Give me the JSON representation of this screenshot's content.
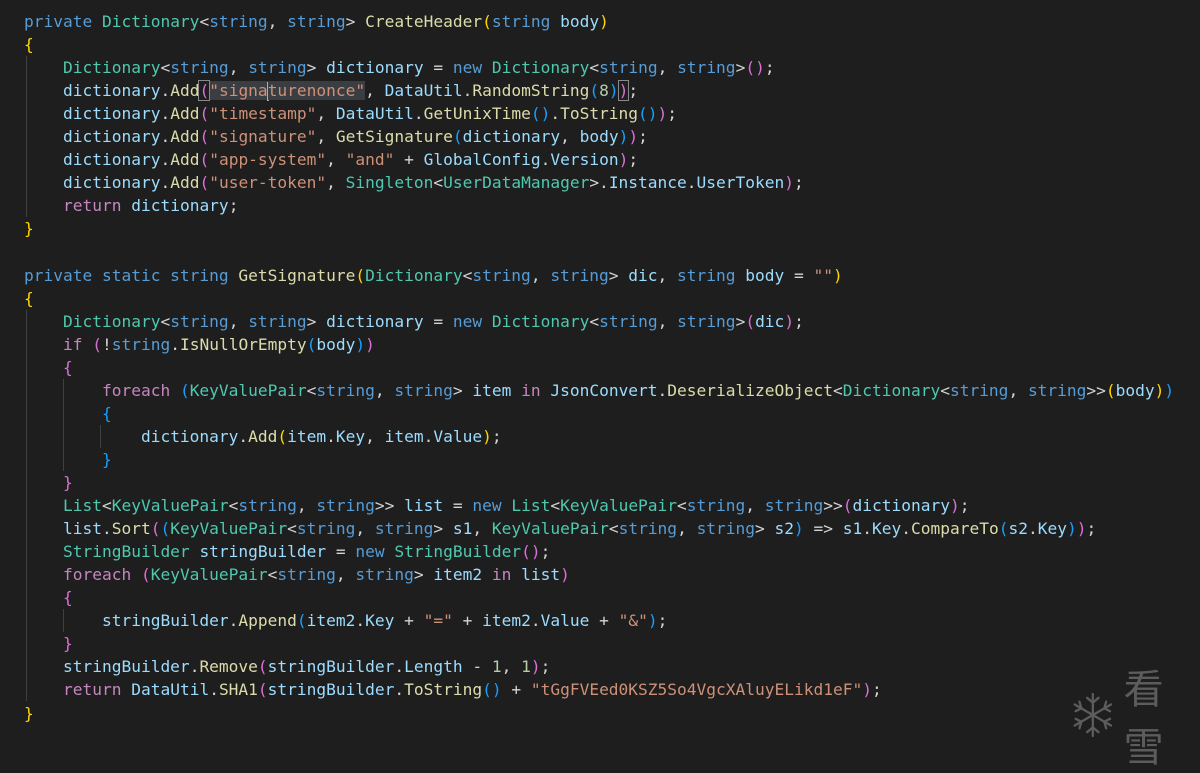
{
  "editor": {
    "language": "csharp",
    "lines": [
      [
        [
          "k",
          "private "
        ],
        [
          "t",
          "Dictionary"
        ],
        [
          "p",
          "<"
        ],
        [
          "k",
          "string"
        ],
        [
          "p",
          ", "
        ],
        [
          "k",
          "string"
        ],
        [
          "p",
          "> "
        ],
        [
          "f",
          "CreateHeader"
        ],
        [
          "b1",
          "("
        ],
        [
          "k",
          "string "
        ],
        [
          "v",
          "body"
        ],
        [
          "b1",
          ")"
        ]
      ],
      [
        [
          "b1",
          "{"
        ]
      ],
      [
        [
          "p",
          "    "
        ],
        [
          "t",
          "Dictionary"
        ],
        [
          "p",
          "<"
        ],
        [
          "k",
          "string"
        ],
        [
          "p",
          ", "
        ],
        [
          "k",
          "string"
        ],
        [
          "p",
          "> "
        ],
        [
          "v",
          "dictionary"
        ],
        [
          "p",
          " = "
        ],
        [
          "k",
          "new "
        ],
        [
          "t",
          "Dictionary"
        ],
        [
          "p",
          "<"
        ],
        [
          "k",
          "string"
        ],
        [
          "p",
          ", "
        ],
        [
          "k",
          "string"
        ],
        [
          "p",
          ">"
        ],
        [
          "b2",
          "("
        ],
        [
          "b2",
          ")"
        ],
        [
          "p",
          ";"
        ]
      ],
      [
        [
          "p",
          "    "
        ],
        [
          "v",
          "dictionary"
        ],
        [
          "p",
          "."
        ],
        [
          "f",
          "Add"
        ],
        [
          "b2hl",
          "("
        ],
        [
          "shl",
          "\"signa"
        ],
        [
          "cursor",
          ""
        ],
        [
          "shl",
          "turenonce\""
        ],
        [
          "p",
          ", "
        ],
        [
          "v",
          "DataUtil"
        ],
        [
          "p",
          "."
        ],
        [
          "f",
          "RandomString"
        ],
        [
          "b3",
          "("
        ],
        [
          "n",
          "8"
        ],
        [
          "b3",
          ")"
        ],
        [
          "b2hl",
          ")"
        ],
        [
          "p",
          ";"
        ]
      ],
      [
        [
          "p",
          "    "
        ],
        [
          "v",
          "dictionary"
        ],
        [
          "p",
          "."
        ],
        [
          "f",
          "Add"
        ],
        [
          "b2",
          "("
        ],
        [
          "s",
          "\"timestamp\""
        ],
        [
          "p",
          ", "
        ],
        [
          "v",
          "DataUtil"
        ],
        [
          "p",
          "."
        ],
        [
          "f",
          "GetUnixTime"
        ],
        [
          "b3",
          "("
        ],
        [
          "b3",
          ")"
        ],
        [
          "p",
          "."
        ],
        [
          "f",
          "ToString"
        ],
        [
          "b3",
          "("
        ],
        [
          "b3",
          ")"
        ],
        [
          "b2",
          ")"
        ],
        [
          "p",
          ";"
        ]
      ],
      [
        [
          "p",
          "    "
        ],
        [
          "v",
          "dictionary"
        ],
        [
          "p",
          "."
        ],
        [
          "f",
          "Add"
        ],
        [
          "b2",
          "("
        ],
        [
          "s",
          "\"signature\""
        ],
        [
          "p",
          ", "
        ],
        [
          "f",
          "GetSignature"
        ],
        [
          "b3",
          "("
        ],
        [
          "v",
          "dictionary"
        ],
        [
          "p",
          ", "
        ],
        [
          "v",
          "body"
        ],
        [
          "b3",
          ")"
        ],
        [
          "b2",
          ")"
        ],
        [
          "p",
          ";"
        ]
      ],
      [
        [
          "p",
          "    "
        ],
        [
          "v",
          "dictionary"
        ],
        [
          "p",
          "."
        ],
        [
          "f",
          "Add"
        ],
        [
          "b2",
          "("
        ],
        [
          "s",
          "\"app-system\""
        ],
        [
          "p",
          ", "
        ],
        [
          "s",
          "\"and\""
        ],
        [
          "p",
          " + "
        ],
        [
          "v",
          "GlobalConfig"
        ],
        [
          "p",
          "."
        ],
        [
          "v",
          "Version"
        ],
        [
          "b2",
          ")"
        ],
        [
          "p",
          ";"
        ]
      ],
      [
        [
          "p",
          "    "
        ],
        [
          "v",
          "dictionary"
        ],
        [
          "p",
          "."
        ],
        [
          "f",
          "Add"
        ],
        [
          "b2",
          "("
        ],
        [
          "s",
          "\"user-token\""
        ],
        [
          "p",
          ", "
        ],
        [
          "t",
          "Singleton"
        ],
        [
          "p",
          "<"
        ],
        [
          "t",
          "UserDataManager"
        ],
        [
          "p",
          ">."
        ],
        [
          "v",
          "Instance"
        ],
        [
          "p",
          "."
        ],
        [
          "v",
          "UserToken"
        ],
        [
          "b2",
          ")"
        ],
        [
          "p",
          ";"
        ]
      ],
      [
        [
          "p",
          "    "
        ],
        [
          "c",
          "return "
        ],
        [
          "v",
          "dictionary"
        ],
        [
          "p",
          ";"
        ]
      ],
      [
        [
          "b1",
          "}"
        ]
      ],
      [],
      [
        [
          "k",
          "private static string "
        ],
        [
          "f",
          "GetSignature"
        ],
        [
          "b1",
          "("
        ],
        [
          "t",
          "Dictionary"
        ],
        [
          "p",
          "<"
        ],
        [
          "k",
          "string"
        ],
        [
          "p",
          ", "
        ],
        [
          "k",
          "string"
        ],
        [
          "p",
          "> "
        ],
        [
          "v",
          "dic"
        ],
        [
          "p",
          ", "
        ],
        [
          "k",
          "string "
        ],
        [
          "v",
          "body"
        ],
        [
          "p",
          " = "
        ],
        [
          "s",
          "\"\""
        ],
        [
          "b1",
          ")"
        ]
      ],
      [
        [
          "b1",
          "{"
        ]
      ],
      [
        [
          "p",
          "    "
        ],
        [
          "t",
          "Dictionary"
        ],
        [
          "p",
          "<"
        ],
        [
          "k",
          "string"
        ],
        [
          "p",
          ", "
        ],
        [
          "k",
          "string"
        ],
        [
          "p",
          "> "
        ],
        [
          "v",
          "dictionary"
        ],
        [
          "p",
          " = "
        ],
        [
          "k",
          "new "
        ],
        [
          "t",
          "Dictionary"
        ],
        [
          "p",
          "<"
        ],
        [
          "k",
          "string"
        ],
        [
          "p",
          ", "
        ],
        [
          "k",
          "string"
        ],
        [
          "p",
          ">"
        ],
        [
          "b2",
          "("
        ],
        [
          "v",
          "dic"
        ],
        [
          "b2",
          ")"
        ],
        [
          "p",
          ";"
        ]
      ],
      [
        [
          "p",
          "    "
        ],
        [
          "c",
          "if "
        ],
        [
          "b2",
          "("
        ],
        [
          "p",
          "!"
        ],
        [
          "k",
          "string"
        ],
        [
          "p",
          "."
        ],
        [
          "f",
          "IsNullOrEmpty"
        ],
        [
          "b3",
          "("
        ],
        [
          "v",
          "body"
        ],
        [
          "b3",
          ")"
        ],
        [
          "b2",
          ")"
        ]
      ],
      [
        [
          "p",
          "    "
        ],
        [
          "b2",
          "{"
        ]
      ],
      [
        [
          "p",
          "        "
        ],
        [
          "c",
          "foreach "
        ],
        [
          "b3",
          "("
        ],
        [
          "t",
          "KeyValuePair"
        ],
        [
          "p",
          "<"
        ],
        [
          "k",
          "string"
        ],
        [
          "p",
          ", "
        ],
        [
          "k",
          "string"
        ],
        [
          "p",
          "> "
        ],
        [
          "v",
          "item "
        ],
        [
          "c",
          "in "
        ],
        [
          "v",
          "JsonConvert"
        ],
        [
          "p",
          "."
        ],
        [
          "f",
          "DeserializeObject"
        ],
        [
          "p",
          "<"
        ],
        [
          "t",
          "Dictionary"
        ],
        [
          "p",
          "<"
        ],
        [
          "k",
          "string"
        ],
        [
          "p",
          ", "
        ],
        [
          "k",
          "string"
        ],
        [
          "p",
          ">>"
        ],
        [
          "b1",
          "("
        ],
        [
          "v",
          "body"
        ],
        [
          "b1",
          ")"
        ],
        [
          "b3",
          ")"
        ]
      ],
      [
        [
          "p",
          "        "
        ],
        [
          "b3",
          "{"
        ]
      ],
      [
        [
          "p",
          "            "
        ],
        [
          "v",
          "dictionary"
        ],
        [
          "p",
          "."
        ],
        [
          "f",
          "Add"
        ],
        [
          "b1",
          "("
        ],
        [
          "v",
          "item"
        ],
        [
          "p",
          "."
        ],
        [
          "v",
          "Key"
        ],
        [
          "p",
          ", "
        ],
        [
          "v",
          "item"
        ],
        [
          "p",
          "."
        ],
        [
          "v",
          "Value"
        ],
        [
          "b1",
          ")"
        ],
        [
          "p",
          ";"
        ]
      ],
      [
        [
          "p",
          "        "
        ],
        [
          "b3",
          "}"
        ]
      ],
      [
        [
          "p",
          "    "
        ],
        [
          "b2",
          "}"
        ]
      ],
      [
        [
          "p",
          "    "
        ],
        [
          "t",
          "List"
        ],
        [
          "p",
          "<"
        ],
        [
          "t",
          "KeyValuePair"
        ],
        [
          "p",
          "<"
        ],
        [
          "k",
          "string"
        ],
        [
          "p",
          ", "
        ],
        [
          "k",
          "string"
        ],
        [
          "p",
          ">> "
        ],
        [
          "v",
          "list"
        ],
        [
          "p",
          " = "
        ],
        [
          "k",
          "new "
        ],
        [
          "t",
          "List"
        ],
        [
          "p",
          "<"
        ],
        [
          "t",
          "KeyValuePair"
        ],
        [
          "p",
          "<"
        ],
        [
          "k",
          "string"
        ],
        [
          "p",
          ", "
        ],
        [
          "k",
          "string"
        ],
        [
          "p",
          ">>"
        ],
        [
          "b2",
          "("
        ],
        [
          "v",
          "dictionary"
        ],
        [
          "b2",
          ")"
        ],
        [
          "p",
          ";"
        ]
      ],
      [
        [
          "p",
          "    "
        ],
        [
          "v",
          "list"
        ],
        [
          "p",
          "."
        ],
        [
          "f",
          "Sort"
        ],
        [
          "b2",
          "("
        ],
        [
          "b3",
          "("
        ],
        [
          "t",
          "KeyValuePair"
        ],
        [
          "p",
          "<"
        ],
        [
          "k",
          "string"
        ],
        [
          "p",
          ", "
        ],
        [
          "k",
          "string"
        ],
        [
          "p",
          "> "
        ],
        [
          "v",
          "s1"
        ],
        [
          "p",
          ", "
        ],
        [
          "t",
          "KeyValuePair"
        ],
        [
          "p",
          "<"
        ],
        [
          "k",
          "string"
        ],
        [
          "p",
          ", "
        ],
        [
          "k",
          "string"
        ],
        [
          "p",
          "> "
        ],
        [
          "v",
          "s2"
        ],
        [
          "b3",
          ")"
        ],
        [
          "p",
          " => "
        ],
        [
          "v",
          "s1"
        ],
        [
          "p",
          "."
        ],
        [
          "v",
          "Key"
        ],
        [
          "p",
          "."
        ],
        [
          "f",
          "CompareTo"
        ],
        [
          "b3",
          "("
        ],
        [
          "v",
          "s2"
        ],
        [
          "p",
          "."
        ],
        [
          "v",
          "Key"
        ],
        [
          "b3",
          ")"
        ],
        [
          "b2",
          ")"
        ],
        [
          "p",
          ";"
        ]
      ],
      [
        [
          "p",
          "    "
        ],
        [
          "t",
          "StringBuilder "
        ],
        [
          "v",
          "stringBuilder"
        ],
        [
          "p",
          " = "
        ],
        [
          "k",
          "new "
        ],
        [
          "t",
          "StringBuilder"
        ],
        [
          "b2",
          "("
        ],
        [
          "b2",
          ")"
        ],
        [
          "p",
          ";"
        ]
      ],
      [
        [
          "p",
          "    "
        ],
        [
          "c",
          "foreach "
        ],
        [
          "b2",
          "("
        ],
        [
          "t",
          "KeyValuePair"
        ],
        [
          "p",
          "<"
        ],
        [
          "k",
          "string"
        ],
        [
          "p",
          ", "
        ],
        [
          "k",
          "string"
        ],
        [
          "p",
          "> "
        ],
        [
          "v",
          "item2 "
        ],
        [
          "c",
          "in "
        ],
        [
          "v",
          "list"
        ],
        [
          "b2",
          ")"
        ]
      ],
      [
        [
          "p",
          "    "
        ],
        [
          "b2",
          "{"
        ]
      ],
      [
        [
          "p",
          "        "
        ],
        [
          "v",
          "stringBuilder"
        ],
        [
          "p",
          "."
        ],
        [
          "f",
          "Append"
        ],
        [
          "b3",
          "("
        ],
        [
          "v",
          "item2"
        ],
        [
          "p",
          "."
        ],
        [
          "v",
          "Key"
        ],
        [
          "p",
          " + "
        ],
        [
          "s",
          "\"=\""
        ],
        [
          "p",
          " + "
        ],
        [
          "v",
          "item2"
        ],
        [
          "p",
          "."
        ],
        [
          "v",
          "Value"
        ],
        [
          "p",
          " + "
        ],
        [
          "s",
          "\"&\""
        ],
        [
          "b3",
          ")"
        ],
        [
          "p",
          ";"
        ]
      ],
      [
        [
          "p",
          "    "
        ],
        [
          "b2",
          "}"
        ]
      ],
      [
        [
          "p",
          "    "
        ],
        [
          "v",
          "stringBuilder"
        ],
        [
          "p",
          "."
        ],
        [
          "f",
          "Remove"
        ],
        [
          "b2",
          "("
        ],
        [
          "v",
          "stringBuilder"
        ],
        [
          "p",
          "."
        ],
        [
          "v",
          "Length"
        ],
        [
          "p",
          " - "
        ],
        [
          "n",
          "1"
        ],
        [
          "p",
          ", "
        ],
        [
          "n",
          "1"
        ],
        [
          "b2",
          ")"
        ],
        [
          "p",
          ";"
        ]
      ],
      [
        [
          "p",
          "    "
        ],
        [
          "c",
          "return "
        ],
        [
          "v",
          "DataUtil"
        ],
        [
          "p",
          "."
        ],
        [
          "f",
          "SHA1"
        ],
        [
          "b2",
          "("
        ],
        [
          "v",
          "stringBuilder"
        ],
        [
          "p",
          "."
        ],
        [
          "f",
          "ToString"
        ],
        [
          "b3",
          "("
        ],
        [
          "b3",
          ")"
        ],
        [
          "p",
          " + "
        ],
        [
          "s",
          "\"tGgFVEed0KSZ5So4VgcXAluyELikd1eF\""
        ],
        [
          "b2",
          ")"
        ],
        [
          "p",
          ";"
        ]
      ],
      [
        [
          "b1",
          "}"
        ]
      ]
    ]
  },
  "watermark": {
    "icon": "snowflake-icon",
    "text": "看雪"
  }
}
